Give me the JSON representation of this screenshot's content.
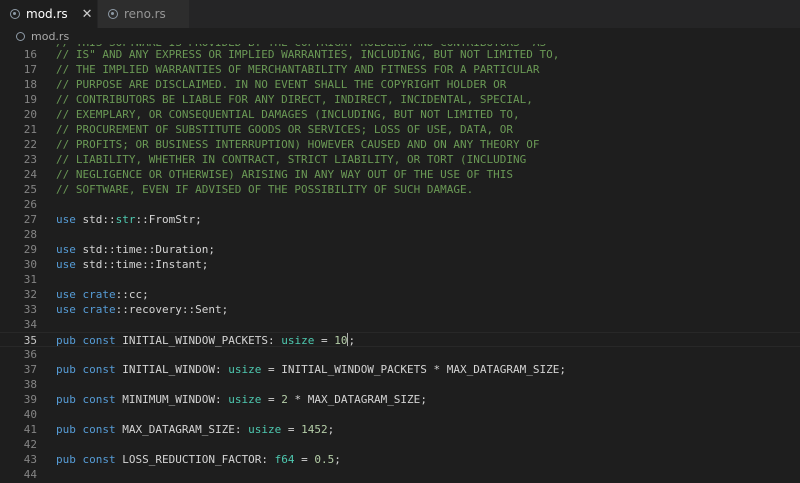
{
  "tabs": [
    {
      "label": "mod.rs",
      "active": true
    },
    {
      "label": "reno.rs",
      "active": false
    }
  ],
  "tab_close_glyph": "✕",
  "breadcrumb": {
    "file": "mod.rs"
  },
  "colors": {
    "comment": "#6a9955",
    "keyword": "#569cd6",
    "type": "#4ec9b0",
    "number": "#b5cea8",
    "text": "#d4d4d4",
    "background": "#1e1e1e"
  },
  "partial_top_line": "// THIS SOFTWARE IS PROVIDED BY THE COPYRIGHT HOLDERS AND CONTRIBUTORS \"AS",
  "lines": [
    {
      "n": "16",
      "t": "// IS\" AND ANY EXPRESS OR IMPLIED WARRANTIES, INCLUDING, BUT NOT LIMITED TO,"
    },
    {
      "n": "17",
      "t": "// THE IMPLIED WARRANTIES OF MERCHANTABILITY AND FITNESS FOR A PARTICULAR"
    },
    {
      "n": "18",
      "t": "// PURPOSE ARE DISCLAIMED. IN NO EVENT SHALL THE COPYRIGHT HOLDER OR"
    },
    {
      "n": "19",
      "t": "// CONTRIBUTORS BE LIABLE FOR ANY DIRECT, INDIRECT, INCIDENTAL, SPECIAL,"
    },
    {
      "n": "20",
      "t": "// EXEMPLARY, OR CONSEQUENTIAL DAMAGES (INCLUDING, BUT NOT LIMITED TO,"
    },
    {
      "n": "21",
      "t": "// PROCUREMENT OF SUBSTITUTE GOODS OR SERVICES; LOSS OF USE, DATA, OR"
    },
    {
      "n": "22",
      "t": "// PROFITS; OR BUSINESS INTERRUPTION) HOWEVER CAUSED AND ON ANY THEORY OF"
    },
    {
      "n": "23",
      "t": "// LIABILITY, WHETHER IN CONTRACT, STRICT LIABILITY, OR TORT (INCLUDING"
    },
    {
      "n": "24",
      "t": "// NEGLIGENCE OR OTHERWISE) ARISING IN ANY WAY OUT OF THE USE OF THIS"
    },
    {
      "n": "25",
      "t": "// SOFTWARE, EVEN IF ADVISED OF THE POSSIBILITY OF SUCH DAMAGE."
    },
    {
      "n": "26",
      "t": ""
    },
    {
      "n": "27",
      "t": "use std::str::FromStr;"
    },
    {
      "n": "28",
      "t": ""
    },
    {
      "n": "29",
      "t": "use std::time::Duration;"
    },
    {
      "n": "30",
      "t": "use std::time::Instant;"
    },
    {
      "n": "31",
      "t": ""
    },
    {
      "n": "32",
      "t": "use crate::cc;"
    },
    {
      "n": "33",
      "t": "use crate::recovery::Sent;"
    },
    {
      "n": "34",
      "t": ""
    },
    {
      "n": "35",
      "t": "pub const INITIAL_WINDOW_PACKETS: usize = 10;",
      "current": true
    },
    {
      "n": "36",
      "t": ""
    },
    {
      "n": "37",
      "t": "pub const INITIAL_WINDOW: usize = INITIAL_WINDOW_PACKETS * MAX_DATAGRAM_SIZE;"
    },
    {
      "n": "38",
      "t": ""
    },
    {
      "n": "39",
      "t": "pub const MINIMUM_WINDOW: usize = 2 * MAX_DATAGRAM_SIZE;"
    },
    {
      "n": "40",
      "t": ""
    },
    {
      "n": "41",
      "t": "pub const MAX_DATAGRAM_SIZE: usize = 1452;"
    },
    {
      "n": "42",
      "t": ""
    },
    {
      "n": "43",
      "t": "pub const LOSS_REDUCTION_FACTOR: f64 = 0.5;"
    },
    {
      "n": "44",
      "t": ""
    }
  ]
}
